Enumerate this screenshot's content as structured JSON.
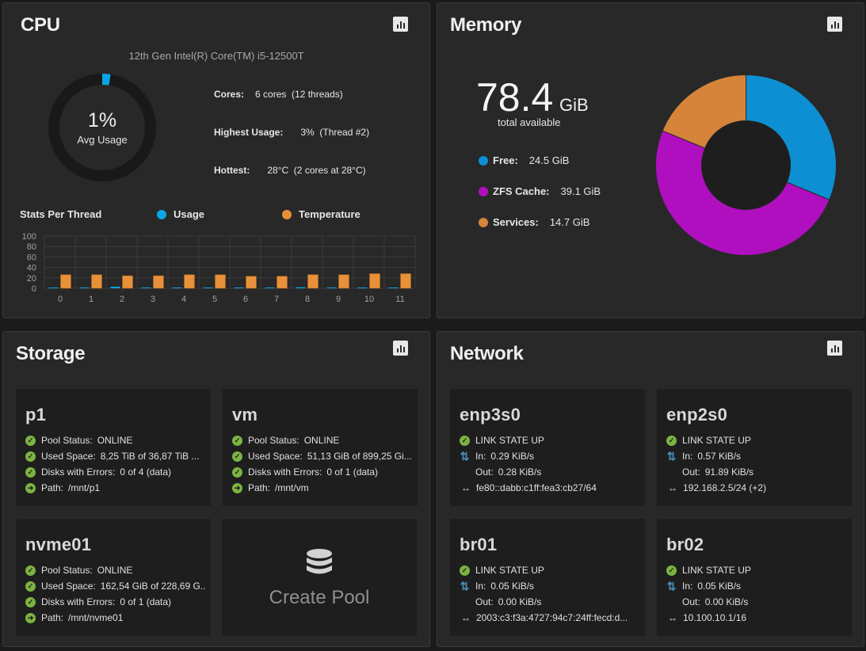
{
  "cpu": {
    "title": "CPU",
    "model": "12th Gen Intel(R) Core(TM) i5-12500T",
    "avg_usage": "1%",
    "avg_usage_label": "Avg Usage",
    "avg_usage_fraction": 0.01,
    "stats": [
      {
        "label": "Cores:",
        "value": "6 cores  (12 threads)"
      },
      {
        "label": "Highest Usage:",
        "value": "3%  (Thread #2)"
      },
      {
        "label": "Hottest:",
        "value": "28°C  (2 cores at 28°C)"
      }
    ],
    "stats_per_thread_label": "Stats Per Thread",
    "legend": [
      {
        "name": "Usage",
        "color": "#0aa5e5"
      },
      {
        "name": "Temperature",
        "color": "#e8913a"
      }
    ]
  },
  "chart_data": {
    "type": "bar",
    "categories": [
      "0",
      "1",
      "2",
      "3",
      "4",
      "5",
      "6",
      "7",
      "8",
      "9",
      "10",
      "11"
    ],
    "series": [
      {
        "name": "Usage",
        "color": "#0aa5e5",
        "values": [
          1,
          0,
          3,
          0,
          1,
          1,
          1,
          1,
          2,
          0,
          1,
          1
        ]
      },
      {
        "name": "Temperature",
        "color": "#e8913a",
        "values": [
          26,
          26,
          24,
          24,
          26,
          26,
          23,
          23,
          26,
          26,
          28,
          28
        ]
      }
    ],
    "yticks": [
      0,
      20,
      40,
      60,
      80,
      100
    ],
    "ylim": [
      0,
      100
    ],
    "grid": true
  },
  "memory": {
    "title": "Memory",
    "total": "78.4",
    "unit": "GiB",
    "total_label": "total available",
    "items": [
      {
        "label": "Free:",
        "value": "24.5 GiB",
        "color": "#0d8fd3",
        "amount": 24.5
      },
      {
        "label": "ZFS Cache:",
        "value": "39.1 GiB",
        "color": "#b00fbf",
        "amount": 39.1
      },
      {
        "label": "Services:",
        "value": "14.7 GiB",
        "color": "#d5843a",
        "amount": 14.7
      }
    ]
  },
  "storage": {
    "title": "Storage",
    "pools": [
      {
        "name": "p1",
        "status_label": "Pool Status:",
        "status": "ONLINE",
        "used_label": "Used Space:",
        "used": "8,25 TiB of 36,87 TiB ...",
        "disks_label": "Disks with Errors:",
        "disks": "0 of 4 (data)",
        "path_label": "Path:",
        "path": "/mnt/p1"
      },
      {
        "name": "vm",
        "status_label": "Pool Status:",
        "status": "ONLINE",
        "used_label": "Used Space:",
        "used": "51,13 GiB of 899,25 Gi...",
        "disks_label": "Disks with Errors:",
        "disks": "0 of 1 (data)",
        "path_label": "Path:",
        "path": "/mnt/vm"
      },
      {
        "name": "nvme01",
        "status_label": "Pool Status:",
        "status": "ONLINE",
        "used_label": "Used Space:",
        "used": "162,54 GiB of 228,69 G...",
        "disks_label": "Disks with Errors:",
        "disks": "0 of 1 (data)",
        "path_label": "Path:",
        "path": "/mnt/nvme01"
      }
    ],
    "create_pool_label": "Create Pool"
  },
  "network": {
    "title": "Network",
    "interfaces": [
      {
        "name": "enp3s0",
        "state": "LINK STATE UP",
        "in_label": "In:",
        "in": "0.29 KiB/s",
        "out_label": "Out:",
        "out": "0.28 KiB/s",
        "addr": "fe80::dabb:c1ff:fea3:cb27/64"
      },
      {
        "name": "enp2s0",
        "state": "LINK STATE UP",
        "in_label": "In:",
        "in": "0.57 KiB/s",
        "out_label": "Out:",
        "out": "91.89 KiB/s",
        "addr": "192.168.2.5/24 (+2)"
      },
      {
        "name": "br01",
        "state": "LINK STATE UP",
        "in_label": "In:",
        "in": "0.05 KiB/s",
        "out_label": "Out:",
        "out": "0.00 KiB/s",
        "addr": "2003:c3:f3a:4727:94c7:24ff:fecd:d..."
      },
      {
        "name": "br02",
        "state": "LINK STATE UP",
        "in_label": "In:",
        "in": "0.05 KiB/s",
        "out_label": "Out:",
        "out": "0.00 KiB/s",
        "addr": "10.100.10.1/16"
      }
    ]
  },
  "icons": {
    "report": "bar-chart-icon",
    "ok": "check-circle-icon",
    "path": "arrow-right-circle-icon",
    "traffic": "up-down-arrows-icon",
    "address": "left-right-arrows-icon",
    "create_pool": "database-icon"
  }
}
